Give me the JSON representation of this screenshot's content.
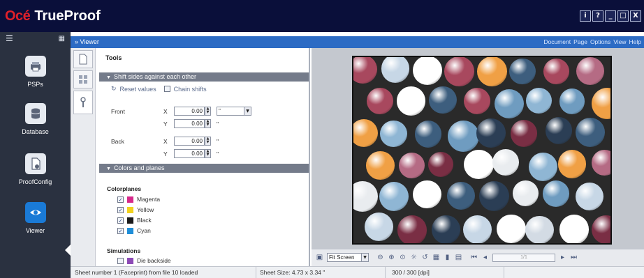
{
  "app": {
    "brand_oce": "Océ",
    "brand_trueproof": "TrueProof"
  },
  "window_buttons": [
    "i",
    "?",
    "_",
    "□",
    "X"
  ],
  "sidebar": {
    "items": [
      {
        "label": "PSPs",
        "icon": "printer-icon"
      },
      {
        "label": "Database",
        "icon": "database-icon"
      },
      {
        "label": "ProofConfig",
        "icon": "document-config-icon"
      },
      {
        "label": "Viewer",
        "icon": "eye-icon",
        "active": true
      }
    ]
  },
  "viewer": {
    "title": "Viewer",
    "menu": [
      "Document",
      "Page",
      "Options",
      "View",
      "Help"
    ]
  },
  "tools": {
    "title": "Tools",
    "shift_section": {
      "title": "Shift sides against each other",
      "reset_label": "Reset values",
      "chain_label": "Chain shifts",
      "front_label": "Front",
      "back_label": "Back",
      "x_label": "X",
      "y_label": "Y",
      "front_x": "0.00",
      "front_y": "0.00",
      "back_x": "0.00",
      "back_y": "0.00",
      "unit": "\"",
      "unit_short": "\""
    },
    "colors_section": {
      "title": "Colors and planes",
      "colorplanes_title": "Colorplanes",
      "planes": [
        {
          "name": "Magenta",
          "color": "#d6288a",
          "checked": true
        },
        {
          "name": "Yellow",
          "color": "#f2d21e",
          "checked": true
        },
        {
          "name": "Black",
          "color": "#1a1a1a",
          "checked": true
        },
        {
          "name": "Cyan",
          "color": "#1f8ed8",
          "checked": true
        }
      ],
      "simulations_title": "Simulations",
      "simulation_item": "Die backside"
    }
  },
  "preview_toolbar": {
    "zoom_mode": "Fit Screen",
    "page_placeholder": "1/1"
  },
  "status": {
    "sheet_info": "Sheet number 1 (Faceprint) from file 10 loaded",
    "sheet_size": "Sheet Size: 4.73 x 3.34 \"",
    "resolution": "300 / 300 [dpi]"
  },
  "colors": {
    "title_bar": "#0a0f3a",
    "sidebar": "#2a3140",
    "viewer_bar": "#2c6bc4",
    "section_bar": "#747b8a",
    "active_tile": "#1a7ad6"
  }
}
